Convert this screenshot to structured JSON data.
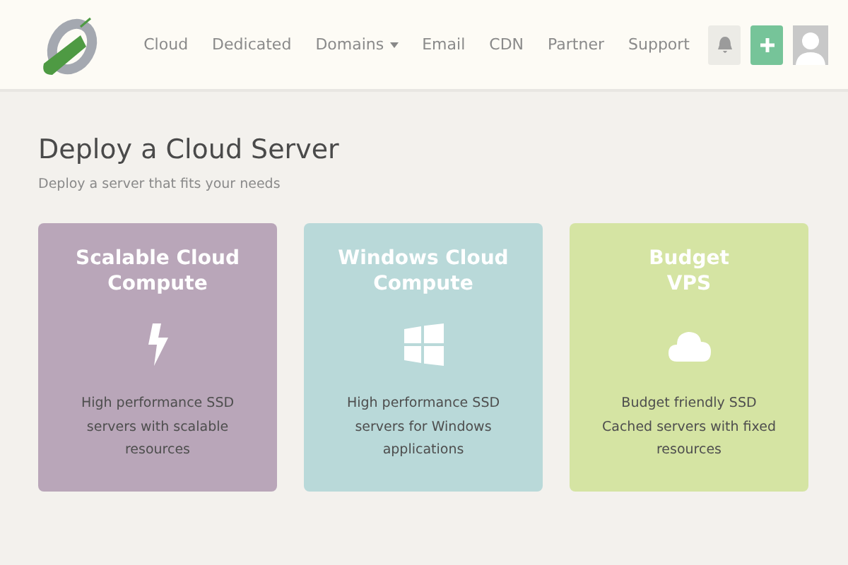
{
  "nav": {
    "items": [
      {
        "label": "Cloud",
        "dropdown": false
      },
      {
        "label": "Dedicated",
        "dropdown": false
      },
      {
        "label": "Domains",
        "dropdown": true
      },
      {
        "label": "Email",
        "dropdown": false
      },
      {
        "label": "CDN",
        "dropdown": false
      },
      {
        "label": "Partner",
        "dropdown": false
      },
      {
        "label": "Support",
        "dropdown": false
      }
    ]
  },
  "page": {
    "title": "Deploy a Cloud Server",
    "subtitle": "Deploy a server that fits your needs"
  },
  "cards": [
    {
      "title": "Scalable Cloud\nCompute",
      "kind": "bolt",
      "color": "#b9a6b9",
      "description": "High performance SSD\nservers with scalable\nresources"
    },
    {
      "title": "Windows Cloud\nCompute",
      "kind": "windows",
      "color": "#b9d9d9",
      "description": "High performance SSD\nservers for Windows\napplications"
    },
    {
      "title": "Budget\nVPS",
      "kind": "cloud",
      "color": "#d5e4a3",
      "description": "Budget friendly SSD\nCached servers with fixed\nresources"
    }
  ]
}
